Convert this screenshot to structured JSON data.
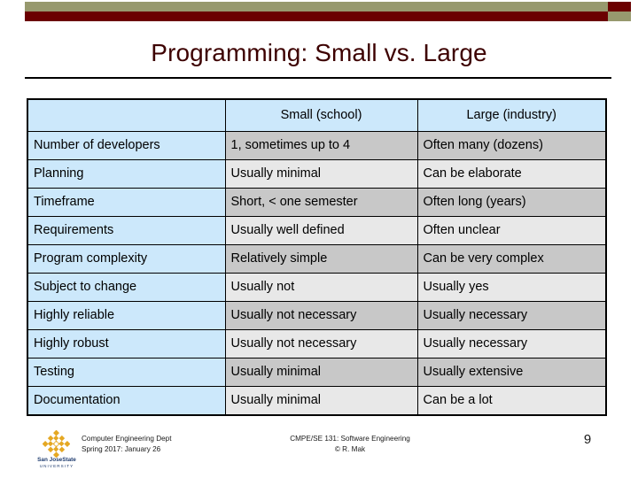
{
  "banner": {
    "khaki_color": "#97996e",
    "maroon_color": "#6b0000"
  },
  "slide": {
    "title": "Programming: Small vs. Large",
    "title_color": "#3d0000"
  },
  "table": {
    "header": [
      "",
      "Small (school)",
      "Large (industry)"
    ],
    "label_bg": "#cce8fb",
    "row_dark_bg": "#c8c8c8",
    "row_light_bg": "#e8e8e8",
    "rows": [
      {
        "label": "Number of developers",
        "small": "1, sometimes up to 4",
        "large": "Often many (dozens)"
      },
      {
        "label": "Planning",
        "small": "Usually minimal",
        "large": "Can be elaborate"
      },
      {
        "label": "Timeframe",
        "small": "Short, < one semester",
        "large": "Often long (years)"
      },
      {
        "label": "Requirements",
        "small": "Usually well defined",
        "large": "Often unclear"
      },
      {
        "label": "Program complexity",
        "small": "Relatively simple",
        "large": "Can be very complex"
      },
      {
        "label": "Subject to change",
        "small": "Usually not",
        "large": "Usually yes"
      },
      {
        "label": "Highly reliable",
        "small": "Usually not necessary",
        "large": "Usually necessary"
      },
      {
        "label": "Highly robust",
        "small": "Usually not necessary",
        "large": "Usually necessary"
      },
      {
        "label": "Testing",
        "small": "Usually minimal",
        "large": "Usually extensive"
      },
      {
        "label": "Documentation",
        "small": "Usually minimal",
        "large": "Can be a lot"
      }
    ]
  },
  "footer": {
    "logo_name": "San JoseState",
    "logo_sub": "UNIVERSITY",
    "logo_color": "#e5a823",
    "dept": "Computer Engineering Dept",
    "term": "Spring 2017: January 26",
    "course": "CMPE/SE 131: Software Engineering",
    "copyright": "© R. Mak",
    "page_number": "9"
  }
}
